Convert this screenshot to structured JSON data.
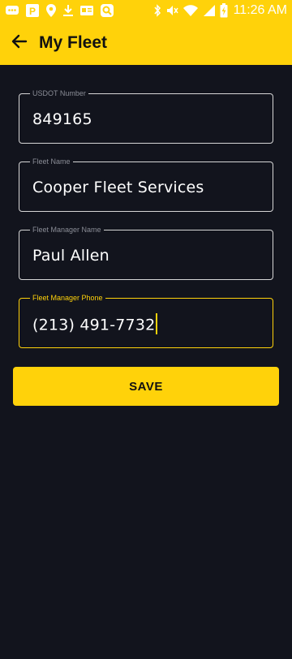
{
  "status_bar": {
    "time": "11:26 AM",
    "icons": [
      "message-icon",
      "parking-icon",
      "location-icon",
      "download-icon",
      "news-icon",
      "search-app-icon",
      "bluetooth-icon",
      "mute-icon",
      "wifi-icon",
      "signal-icon",
      "battery-charging-icon"
    ]
  },
  "app_bar": {
    "title": "My Fleet",
    "back_icon": "arrow-left-icon"
  },
  "form": {
    "usdot": {
      "label": "USDOT Number",
      "value": "849165"
    },
    "fleet_name": {
      "label": "Fleet Name",
      "value": "Cooper Fleet Services"
    },
    "manager_name": {
      "label": "Fleet Manager Name",
      "value": "Paul Allen"
    },
    "manager_phone": {
      "label": "Fleet Manager Phone",
      "value": "(213) 491-7732",
      "focused": true
    }
  },
  "save_button": {
    "label": "SAVE"
  },
  "colors": {
    "accent": "#ffd20a",
    "background": "#12141d",
    "field_border": "#d6d6d6",
    "label_muted": "#8a8d96",
    "text": "#ffffff"
  }
}
